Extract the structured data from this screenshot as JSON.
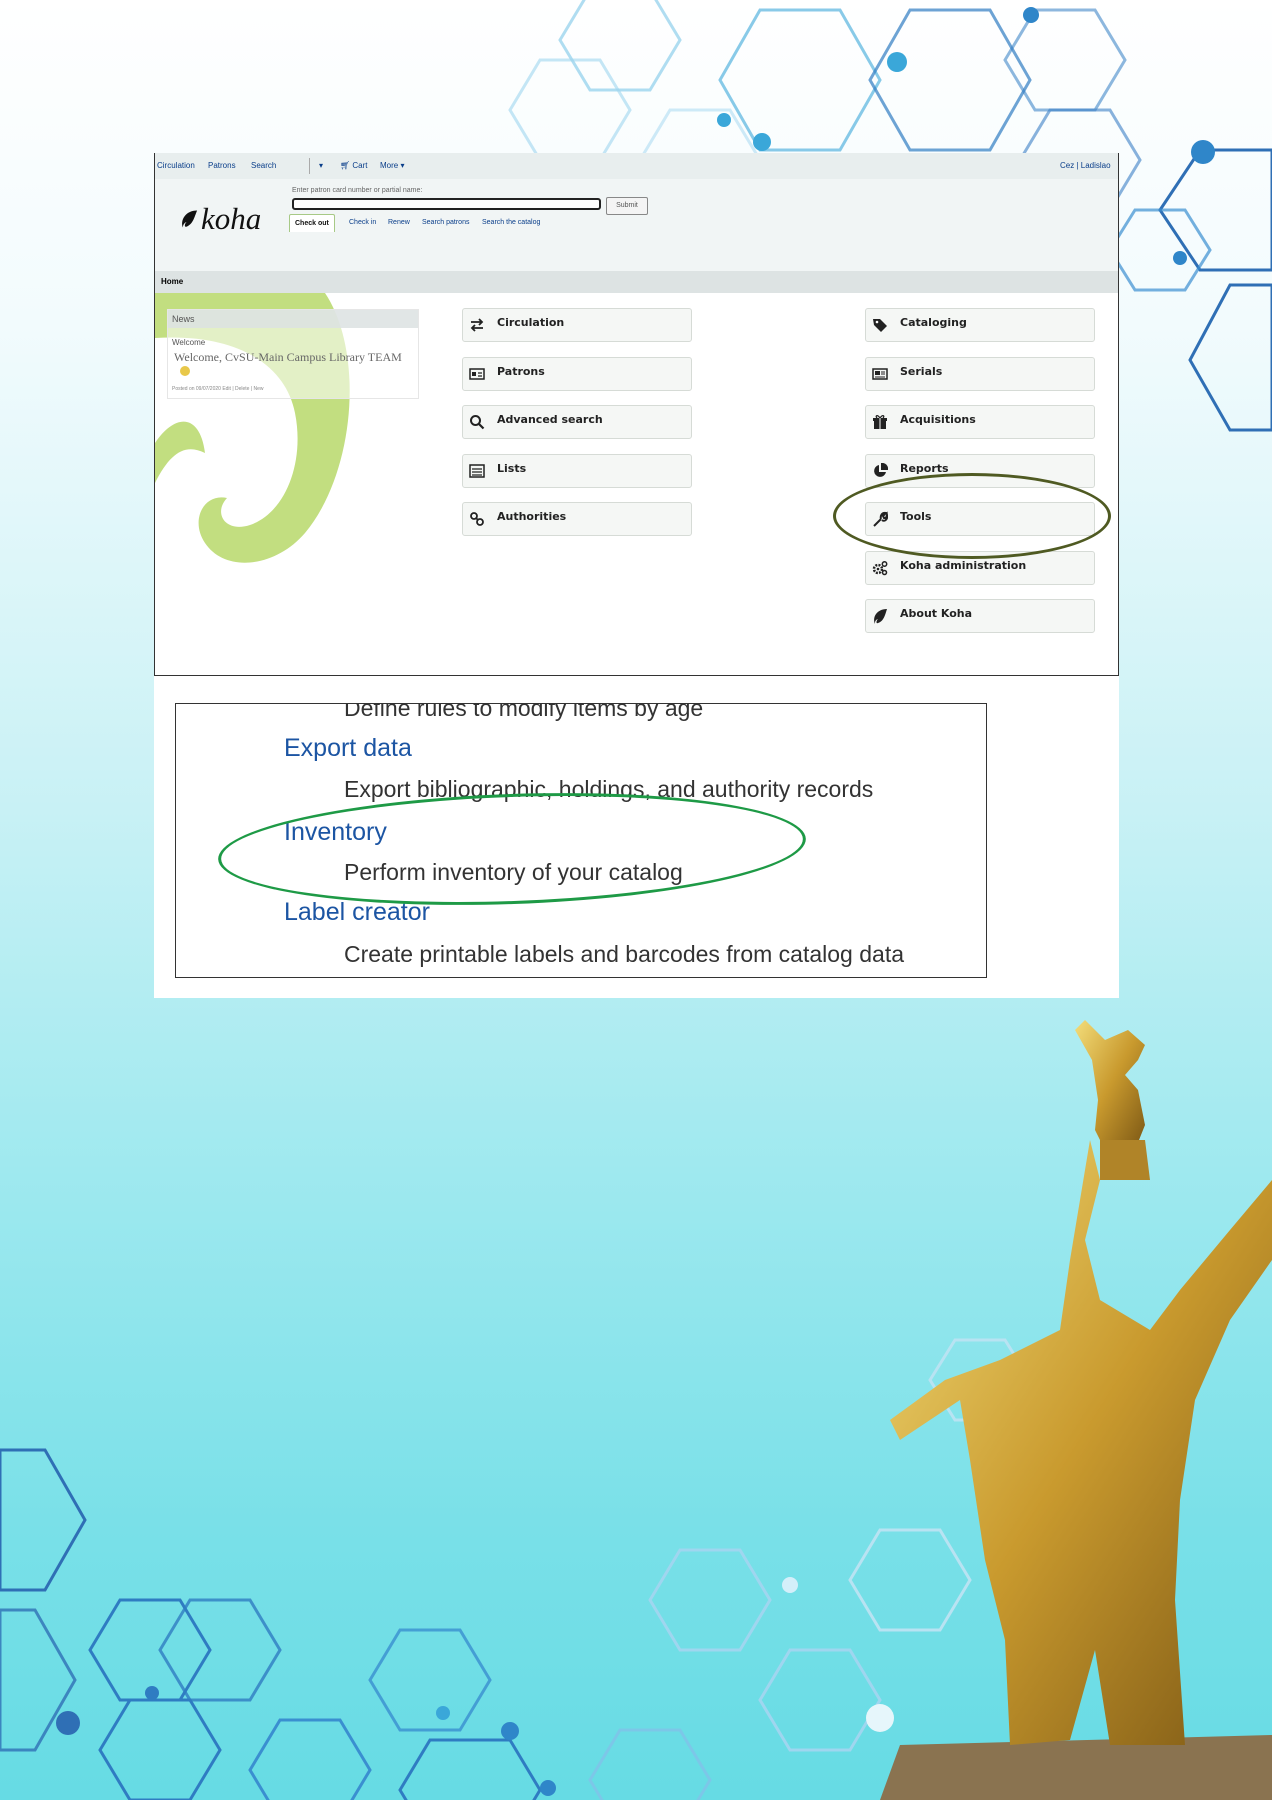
{
  "top_nav": {
    "circulation": "Circulation",
    "patrons": "Patrons",
    "search": "Search",
    "cart": "Cart",
    "more": "More",
    "user": "Cez | Ladislao"
  },
  "header": {
    "logo_text": "koha",
    "patron_hint": "Enter patron card number or partial name:",
    "submit_label": "Submit",
    "tabs": [
      "Check out",
      "Check in",
      "Renew",
      "Search patrons",
      "Search the catalog"
    ]
  },
  "breadcrumb": "Home",
  "news": {
    "heading": "News",
    "welcome_label": "Welcome",
    "message": "Welcome, CvSU-Main Campus Library TEAM",
    "meta": "Posted on 09/07/2020 Edit | Delete | New"
  },
  "modules_left": [
    "Circulation",
    "Patrons",
    "Advanced search",
    "Lists",
    "Authorities"
  ],
  "modules_right": [
    "Cataloging",
    "Serials",
    "Acquisitions",
    "Reports",
    "Tools",
    "Koha administration",
    "About Koha"
  ],
  "highlight_color_tools": "#4f5a22",
  "highlight_color_inventory": "#1e9a46",
  "tools_list": {
    "partial_top": "Define rules to modify items by age",
    "items": [
      {
        "title": "Export data",
        "desc": "Export bibliographic, holdings, and authority records"
      },
      {
        "title": "Inventory",
        "desc": "Perform inventory of your catalog"
      },
      {
        "title": "Label creator",
        "desc": "Create printable labels and barcodes from catalog data"
      }
    ]
  }
}
